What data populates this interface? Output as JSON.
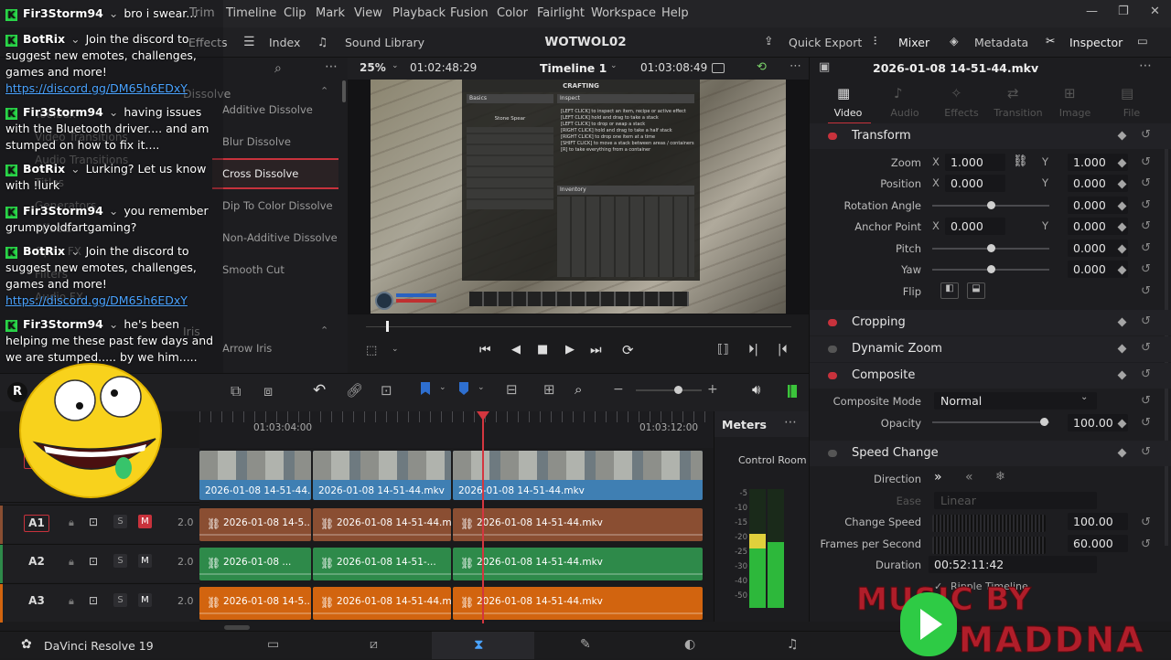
{
  "menu": [
    "Trim",
    "Timeline",
    "Clip",
    "Mark",
    "View",
    "Playback",
    "Fusion",
    "Color",
    "Fairlight",
    "Workspace",
    "Help"
  ],
  "toolbar": {
    "effects": "Effects",
    "index": "Index",
    "sound_library": "Sound Library",
    "project_title": "WOTWOL02",
    "quick_export": "Quick Export",
    "mixer": "Mixer",
    "metadata": "Metadata",
    "inspector": "Inspector"
  },
  "effects_panel": {
    "category": "Dissolve",
    "category2": "Iris",
    "side_items": [
      "Toolbox",
      "Video Transitions",
      "Audio Transitions",
      "Titles",
      "Generators",
      "Effects",
      "Open FX",
      "Filters",
      "Audio FX"
    ],
    "items": [
      "Additive Dissolve",
      "Blur Dissolve",
      "Cross Dissolve",
      "Dip To Color Dissolve",
      "Non-Additive Dissolve",
      "Smooth Cut",
      "Arrow Iris"
    ],
    "selected_index": 2
  },
  "viewer": {
    "zoom": "25%",
    "timecode_left": "01:02:48:29",
    "timeline_name": "Timeline 1",
    "timecode_right": "01:03:08:49",
    "game": {
      "title": "CRAFTING",
      "basics": "Basics",
      "inspect": "Inspect",
      "inventory": "Inventory",
      "item": "Stone Spear",
      "instructions": [
        "[LEFT CLICK] to inspect an item, recipe or active effect",
        "[LEFT CLICK] hold and drag to take a stack",
        "[LEFT CLICK] to drop or swap a stack",
        "[RIGHT CLICK] hold and drag to take a half stack",
        "[RIGHT CLICK] to drop one item at a time",
        "[SHIFT CLICK] to move a stack between areas / containers",
        "[R] to take everything from a container"
      ]
    }
  },
  "timeline": {
    "ruler_marks": [
      "01:03:04:00",
      "01:03:12:00"
    ],
    "video_clips": [
      "2026-01-08 14-51-44....",
      "2026-01-08 14-51-44.mkv",
      "2026-01-08 14-51-44.mkv"
    ],
    "tracks": [
      {
        "name": "A1",
        "level": "2.0",
        "clips": [
          "2026-01-08 14-5...",
          "2026-01-08 14-51-44.mkv",
          "2026-01-08 14-51-44.mkv"
        ],
        "color": "#8a4e32"
      },
      {
        "name": "A2",
        "level": "2.0",
        "clips": [
          "2026-01-08 ...",
          "2026-01-08 14-51-...",
          "2026-01-08 14-51-44.mkv"
        ],
        "color": "#2e8a4a"
      },
      {
        "name": "A3",
        "level": "2.0",
        "clips": [
          "2026-01-08 14-5...",
          "2026-01-08 14-51-44.mkv",
          "2026-01-08 14-51-44.mkv"
        ],
        "color": "#d2640f"
      }
    ],
    "track_buttons": {
      "s": "S",
      "m": "M"
    },
    "playhead_fraction": 0.55
  },
  "meters": {
    "title": "Meters",
    "control_room": "Control Room",
    "scale": [
      "-5",
      "-10",
      "-15",
      "-20",
      "-25",
      "-30",
      "-40",
      "-50"
    ],
    "left_level": 0.62,
    "right_level": 0.55
  },
  "inspector": {
    "filename": "2026-01-08 14-51-44.mkv",
    "tabs": [
      "Video",
      "Audio",
      "Effects",
      "Transition",
      "Image",
      "File"
    ],
    "transform": {
      "title": "Transform",
      "zoom_label": "Zoom",
      "zoom_x": "1.000",
      "zoom_y": "1.000",
      "position_label": "Position",
      "pos_x": "0.000",
      "pos_y": "0.000",
      "rotation_label": "Rotation Angle",
      "rotation": "0.000",
      "anchor_label": "Anchor Point",
      "anchor_x": "0.000",
      "anchor_y": "0.000",
      "pitch_label": "Pitch",
      "pitch": "0.000",
      "yaw_label": "Yaw",
      "yaw": "0.000",
      "flip_label": "Flip",
      "x": "X",
      "y": "Y"
    },
    "cropping": "Cropping",
    "dynamic_zoom": "Dynamic Zoom",
    "composite": {
      "title": "Composite",
      "mode_label": "Composite Mode",
      "mode": "Normal",
      "opacity_label": "Opacity",
      "opacity": "100.00"
    },
    "speed_change": {
      "title": "Speed Change",
      "direction_label": "Direction",
      "ease_label": "Ease",
      "ease": "Linear",
      "change_speed_label": "Change Speed",
      "change_speed": "100.00",
      "fps_label": "Frames per Second",
      "fps": "60.000",
      "duration_label": "Duration",
      "duration": "00:52:11:42",
      "ripple": "Ripple Timeline"
    }
  },
  "bottom": {
    "app": "DaVinci Resolve 19"
  },
  "chat": [
    {
      "user": "Fir3Storm94",
      "text": "bro i swear..."
    },
    {
      "user": "BotRix",
      "text": "Join the discord to suggest new emotes, challenges, games and more!",
      "link": "https://discord.gg/DM65h6EDxY"
    },
    {
      "user": "Fir3Storm94",
      "text": "having issues with the Bluetooth driver.... and am stumped on how to fix it...."
    },
    {
      "user": "BotRix",
      "text": "Lurking? Let us know with !lurk"
    },
    {
      "user": "Fir3Storm94",
      "text": "you remember grumpyoldfartgaming?"
    },
    {
      "user": "BotRix",
      "text": "Join the discord to suggest new emotes, challenges, games and more!",
      "link": "https://discord.gg/DM65h6EDxY"
    },
    {
      "user": "Fir3Storm94",
      "text": "he's been helping me these past few days and we are stumped..... by we him....."
    }
  ],
  "watermark": {
    "line1": "MUSIC BY",
    "line2": "MADDNA"
  },
  "colors": {
    "accent_red": "#c8323c",
    "video_clip": "#3f7fb3",
    "chat_green": "#2bd94a",
    "link": "#4aa3ff"
  }
}
